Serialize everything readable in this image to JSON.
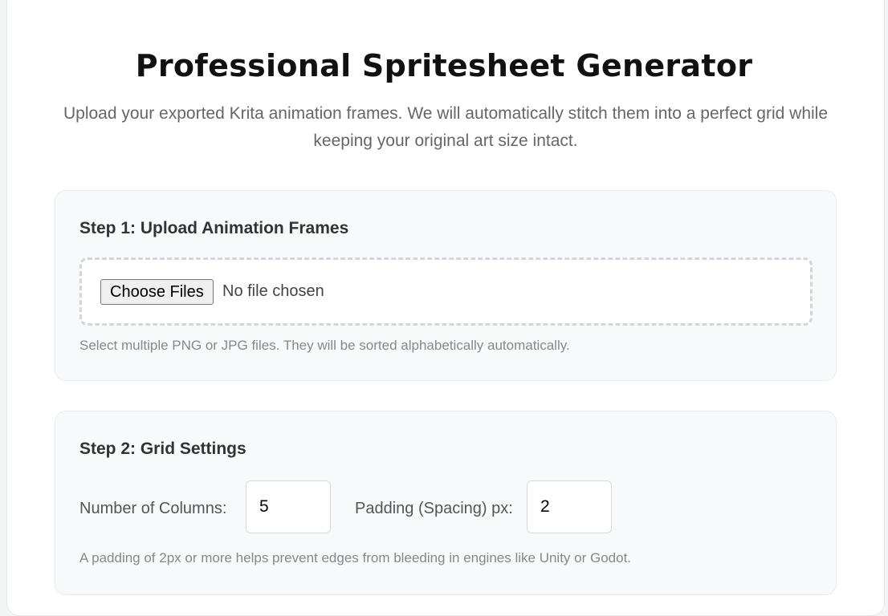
{
  "header": {
    "title": "Professional Spritesheet Generator",
    "subtitle": "Upload your exported Krita animation frames. We will automatically stitch them into a perfect grid while keeping your original art size intact."
  },
  "step1": {
    "title": "Step 1: Upload Animation Frames",
    "choose_button": "Choose Files",
    "file_status": "No file chosen",
    "hint": "Select multiple PNG or JPG files. They will be sorted alphabetically automatically."
  },
  "step2": {
    "title": "Step 2: Grid Settings",
    "columns_label": "Number of Columns:",
    "columns_value": "5",
    "padding_label": "Padding (Spacing) px:",
    "padding_value": "2",
    "hint": "A padding of 2px or more helps prevent edges from bleeding in engines like Unity or Godot."
  }
}
